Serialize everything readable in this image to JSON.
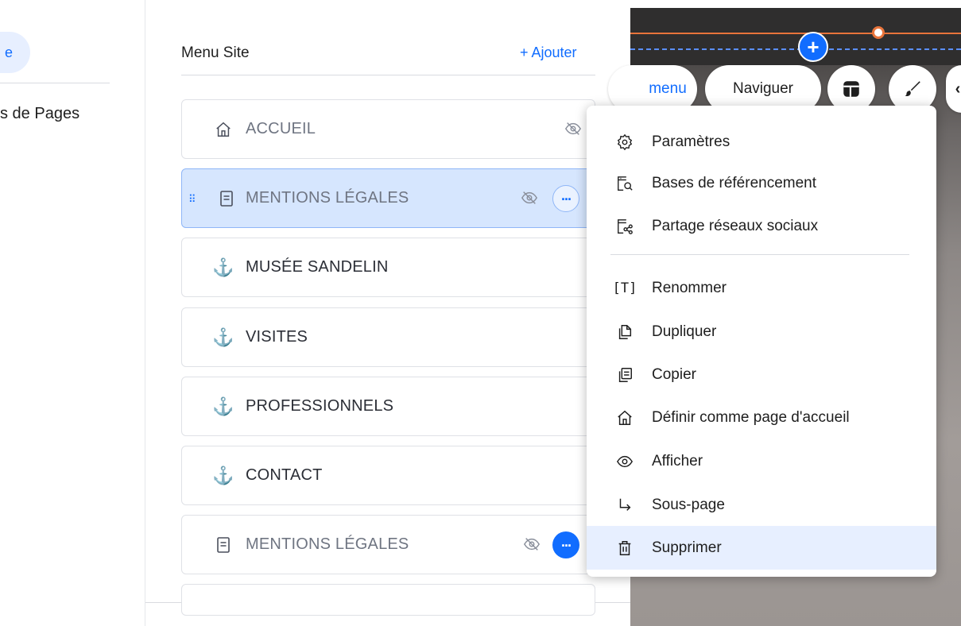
{
  "left_nav": {
    "active_label_fragment": "e",
    "item_label_fragment": "s de Pages"
  },
  "menu": {
    "title": "Menu Site",
    "add_label": "+ Ajouter",
    "items": [
      {
        "label": "ACCUEIL",
        "icon": "home-icon",
        "hidden": true
      },
      {
        "label": "MENTIONS LÉGALES",
        "icon": "page-icon",
        "hidden": true,
        "selected": true
      },
      {
        "label": "MUSÉE SANDELIN",
        "icon": "anchor-icon"
      },
      {
        "label": "VISITES",
        "icon": "anchor-icon"
      },
      {
        "label": "PROFESSIONNELS",
        "icon": "anchor-icon"
      },
      {
        "label": "CONTACT",
        "icon": "anchor-icon"
      },
      {
        "label": "MENTIONS LÉGALES",
        "icon": "page-icon",
        "hidden": true
      }
    ]
  },
  "toolbar": {
    "menu_label": "menu",
    "nav_label": "Naviguer"
  },
  "context_menu": {
    "items": [
      {
        "label": "Paramètres",
        "icon": "gear-icon"
      },
      {
        "label": "Bases de référencement",
        "icon": "seo-icon"
      },
      {
        "label": "Partage réseaux sociaux",
        "icon": "share-icon"
      },
      {
        "label": "Renommer",
        "icon": "rename-icon"
      },
      {
        "label": "Dupliquer",
        "icon": "duplicate-icon"
      },
      {
        "label": "Copier",
        "icon": "copy-icon"
      },
      {
        "label": "Définir comme page d'accueil",
        "icon": "home-icon"
      },
      {
        "label": "Afficher",
        "icon": "eye-icon"
      },
      {
        "label": "Sous-page",
        "icon": "subpage-icon"
      },
      {
        "label": "Supprimer",
        "icon": "trash-icon",
        "active": true
      }
    ]
  },
  "colors": {
    "accent": "#116dff",
    "selected_bg": "#d6e6fe",
    "hover_bg": "#e7efff"
  }
}
